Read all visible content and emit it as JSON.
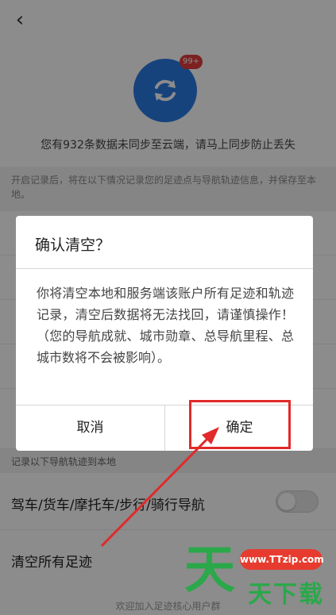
{
  "header": {
    "back_icon": "‹"
  },
  "sync": {
    "badge": "99+",
    "message": "您有932条数据未同步至云端，请马上同步防止丢失",
    "icon_color": "#2a7be4"
  },
  "record_note": "开启记录后，将在以下情况记录您的足迹点与导航轨迹信息，并保存至本地。",
  "settings_rows": [
    "",
    "",
    "",
    "",
    ""
  ],
  "nav_section_label": "记录以下导航轨迹到本地",
  "nav_row": {
    "label": "驾车/货车/摩托车/步行/骑行导航",
    "toggle_on": false
  },
  "clear_row": {
    "label": "清空所有足迹"
  },
  "footer": "欢迎加入足迹核心用户群",
  "dialog": {
    "title": "确认清空？",
    "body": "你将清空本地和服务端该账户所有足迹和轨迹记录，清空后数据将无法找回，请谨慎操作！（您的导航成就、城市勋章、总导航里程、总城市数将不会被影响）。",
    "cancel_label": "取消",
    "confirm_label": "确定"
  },
  "highlight_color": "#e12a2a",
  "watermark": {
    "site": "www.TTzip.com",
    "big_char": "天",
    "small_text": "天下载"
  }
}
